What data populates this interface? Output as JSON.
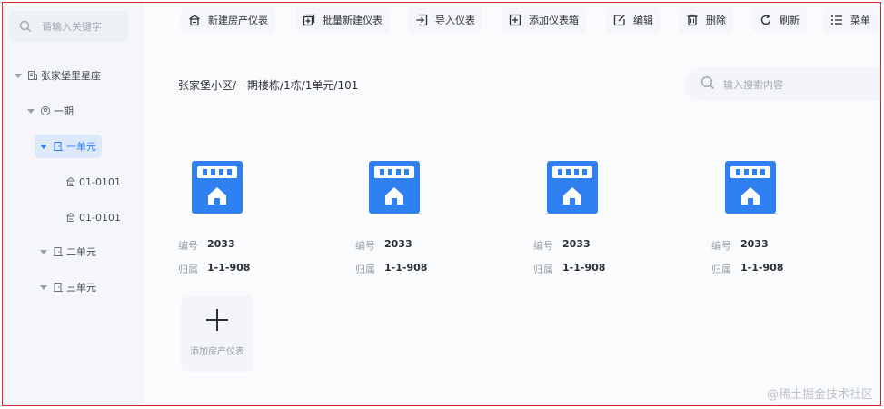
{
  "sidebar": {
    "search_placeholder": "请输入关键字",
    "tree": [
      {
        "label": "张家堡里星座"
      },
      {
        "label": "一期"
      },
      {
        "label": "一单元"
      },
      {
        "label": "01-0101"
      },
      {
        "label": "01-0101"
      },
      {
        "label": "二单元"
      },
      {
        "label": "三单元"
      }
    ]
  },
  "toolbar": {
    "items": [
      {
        "label": "新建房产仪表",
        "icon": "building-icon"
      },
      {
        "label": "批量新建仪表",
        "icon": "batch-add-icon"
      },
      {
        "label": "导入仪表",
        "icon": "import-icon"
      },
      {
        "label": "添加仪表箱",
        "icon": "add-box-icon"
      },
      {
        "label": "编辑",
        "icon": "edit-icon"
      },
      {
        "label": "删除",
        "icon": "trash-icon"
      },
      {
        "label": "刷新",
        "icon": "refresh-icon"
      },
      {
        "label": "菜单",
        "icon": "menu-icon"
      }
    ]
  },
  "main": {
    "breadcrumb": "张家堡小区/一期楼栋/1栋/1单元/101",
    "search_placeholder": "输入搜索内容",
    "cards": [
      {
        "id_label": "编号",
        "id_value": "2033",
        "owner_label": "归属",
        "owner_value": "1-1-908"
      },
      {
        "id_label": "编号",
        "id_value": "2033",
        "owner_label": "归属",
        "owner_value": "1-1-908"
      },
      {
        "id_label": "编号",
        "id_value": "2033",
        "owner_label": "归属",
        "owner_value": "1-1-908"
      },
      {
        "id_label": "编号",
        "id_value": "2033",
        "owner_label": "归属",
        "owner_value": "1-1-908"
      }
    ],
    "add_label": "添加房产仪表"
  },
  "watermark": "@稀土掘金技术社区",
  "colors": {
    "accent": "#2d7df6",
    "meter_blue": "#2f80f0",
    "border": "#e0262f"
  }
}
